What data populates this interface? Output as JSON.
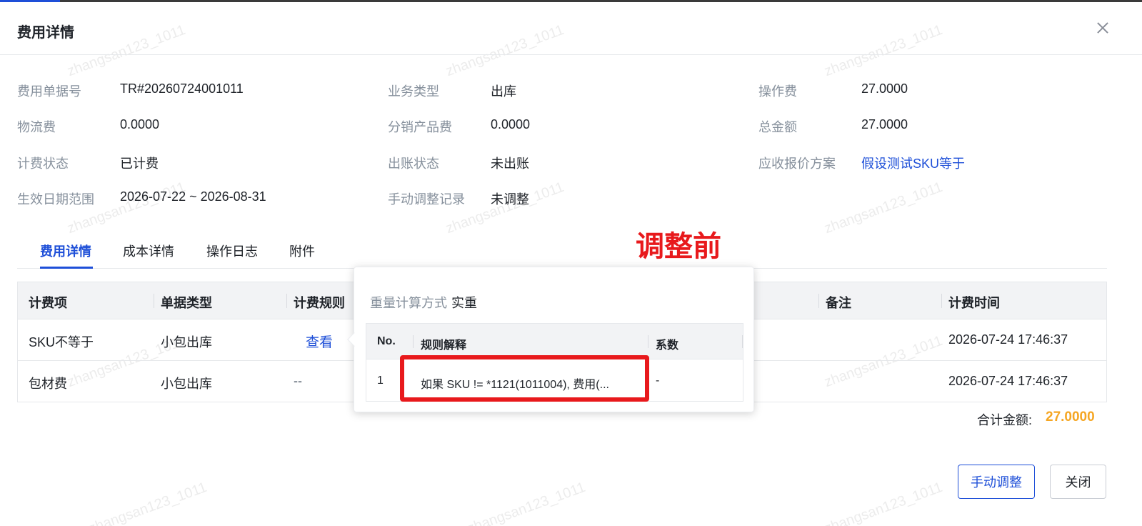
{
  "modal": {
    "title": "费用详情",
    "close_icon": "close-icon",
    "watermark_text": "zhangsan123_1011"
  },
  "info": {
    "fee_no_label": "费用单据号",
    "fee_no": "TR#20260724001011",
    "biz_type_label": "业务类型",
    "biz_type": "出库",
    "operation_fee_label": "操作费",
    "operation_fee": "27.0000",
    "logistics_fee_label": "物流费",
    "logistics_fee": "0.0000",
    "distribution_fee_label": "分销产品费",
    "distribution_fee": "0.0000",
    "total_amount_label": "总金额",
    "total_amount": "27.0000",
    "billing_status_label": "计费状态",
    "billing_status": "已计费",
    "bill_status_label": "出账状态",
    "bill_status": "未出账",
    "quote_plan_label": "应收报价方案",
    "quote_plan": "假设测试SKU等于",
    "effective_range_label": "生效日期范围",
    "effective_range": "2026-07-22 ~ 2026-08-31",
    "manual_record_label": "手动调整记录",
    "manual_record": "未调整"
  },
  "tabs": [
    {
      "label": "费用详情",
      "active": true
    },
    {
      "label": "成本详情",
      "active": false
    },
    {
      "label": "操作日志",
      "active": false
    },
    {
      "label": "附件",
      "active": false
    }
  ],
  "table": {
    "columns": [
      "计费项",
      "单据类型",
      "计费规则",
      "备注",
      "计费时间"
    ],
    "rows": [
      {
        "item": "SKU不等于",
        "doc_type": "小包出库",
        "rule": "查看",
        "remark": "",
        "time": "2026-07-24 17:46:37"
      },
      {
        "item": "包材费",
        "doc_type": "小包出库",
        "rule": "--",
        "remark": "",
        "time": "2026-07-24 17:46:37"
      }
    ]
  },
  "summary": {
    "label": "合计金额:",
    "value": "27.0000"
  },
  "buttons": {
    "adjust": "手动调整",
    "close": "关闭"
  },
  "annotation": "调整前",
  "popover": {
    "title_label": "重量计算方式",
    "title_value": "实重",
    "columns": [
      "No.",
      "规则解释",
      "系数"
    ],
    "rows": [
      {
        "no": "1",
        "rule": "如果 SKU != *1121(1011004), 费用(...",
        "coef": "-"
      }
    ]
  },
  "colors": {
    "primary": "#1e4fd8",
    "amount": "#f5a623",
    "annotation": "#e8191c"
  }
}
